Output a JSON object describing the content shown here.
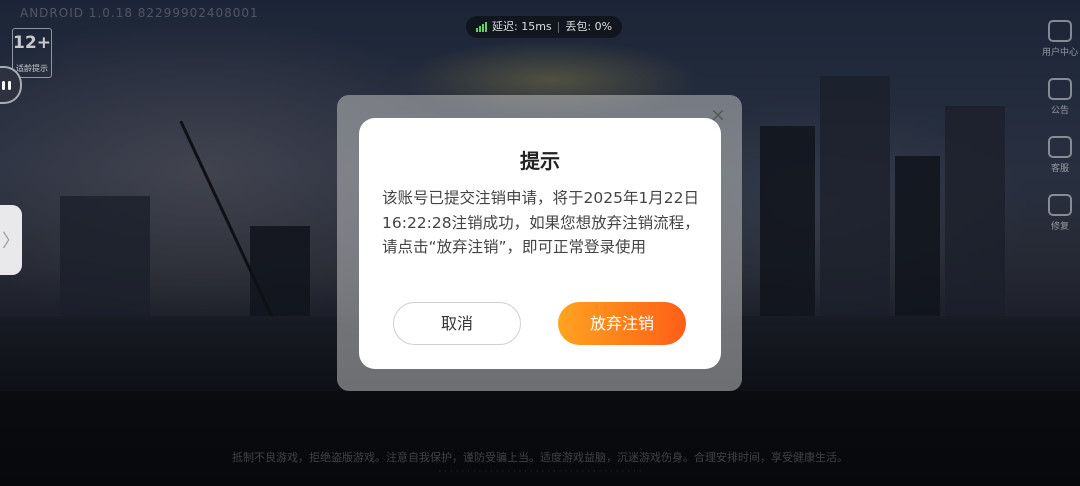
{
  "hud": {
    "device_id": "ANDROID 1.0.18 82299902408001",
    "age_rating": "12+",
    "age_rating_note": "适龄提示",
    "net": {
      "latency_label": "延迟: 15ms",
      "loss_label": "丢包: 0%"
    }
  },
  "right_menu": [
    {
      "label": "用户中心",
      "icon": "user-center-icon"
    },
    {
      "label": "公告",
      "icon": "announcement-icon"
    },
    {
      "label": "客服",
      "icon": "customer-service-icon"
    },
    {
      "label": "修复",
      "icon": "repair-icon"
    }
  ],
  "footer_notice": {
    "line1": "抵制不良游戏，拒绝盗版游戏。注意自我保护，谨防受骗上当。适度游戏益脑，沉迷游戏伤身。合理安排时间，享受健康生活。"
  },
  "dialog": {
    "title": "提示",
    "message": "该账号已提交注销申请，将于2025年1月22日16:22:28注销成功，如果您想放弃注销流程，请点击“放弃注销”，即可正常登录使用",
    "cancel_label": "取消",
    "confirm_label": "放弃注销",
    "close_glyph": "×"
  },
  "side_handle_glyph": "〉",
  "colors": {
    "confirm_gradient_start": "#ffa31f",
    "confirm_gradient_end": "#ff5e16",
    "signal": "#5fd35f"
  }
}
